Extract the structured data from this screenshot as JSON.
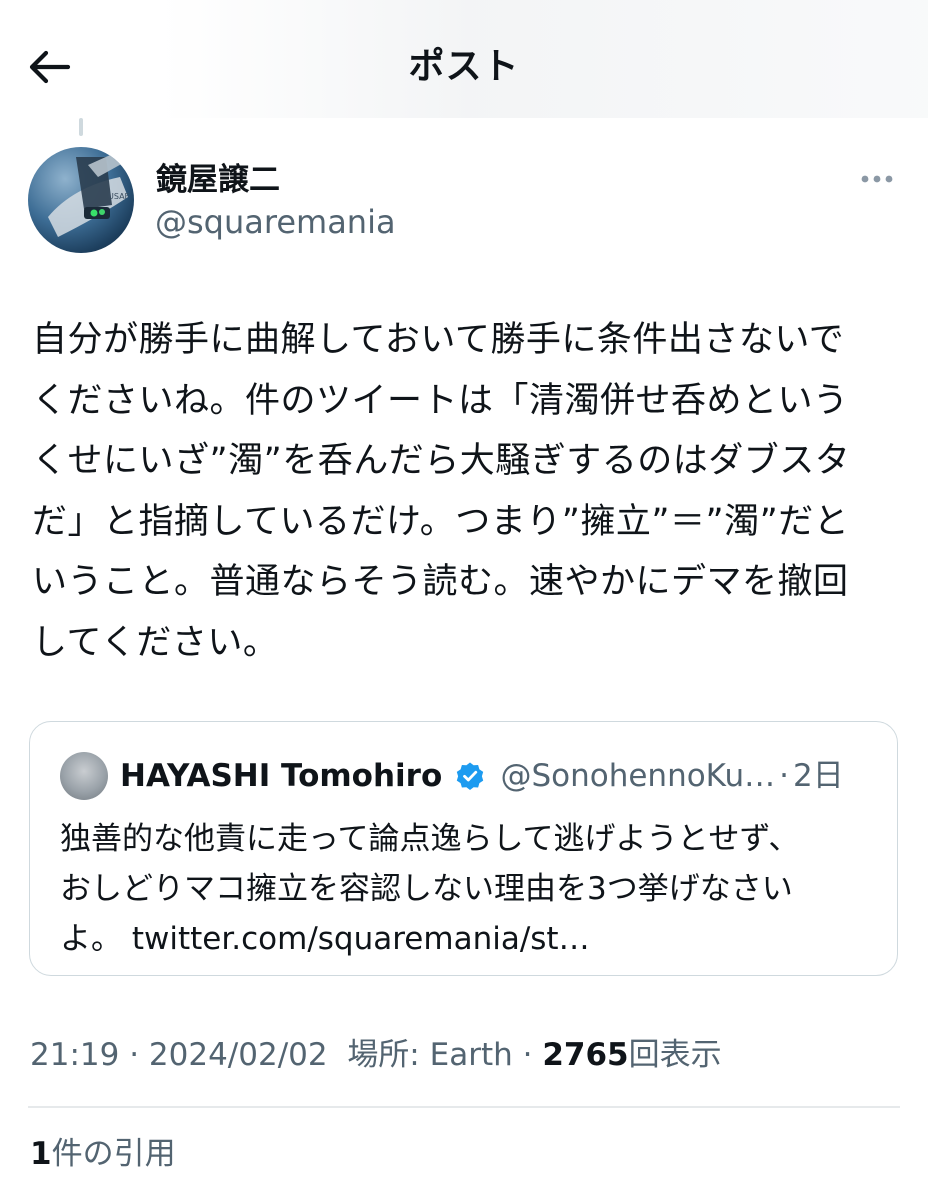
{
  "header": {
    "title": "ポスト",
    "back_icon": "arrow-left-icon"
  },
  "author": {
    "display_name": "鏡屋譲二",
    "handle": "@squaremania",
    "avatar_icon": "profile-avatar",
    "more_icon": "more-horizontal-icon"
  },
  "tweet": {
    "text": "自分が勝手に曲解しておいて勝手に条件出さないで\nくださいね。件のツイートは「清濁併せ呑めという\nくせにいざ”濁”を呑んだら大騒ぎするのはダブスタ\nだ」と指摘しているだけ。つまり”擁立”＝”濁”だと\nいうこと。普通ならそう読む。速やかにデマを撤回\nしてください。"
  },
  "quote": {
    "name": "HAYASHI Tomohiro",
    "verified_icon": "verified-badge-icon",
    "handle": "@SonohennoKu…",
    "separator": "·",
    "time": "2日",
    "text": "独善的な他責に走って論点逸らして逃げようとせず、\nおしどりマコ擁立を容認しない理由を3つ挙げなさい\nよ。 twitter.com/squaremania/st…"
  },
  "meta": {
    "time": "21:19",
    "sep1": " · ",
    "date": "2024/02/02",
    "location_label": "場所: ",
    "location": "Earth",
    "sep2": " · ",
    "views_count": "2765",
    "views_label": "回表示"
  },
  "quotes": {
    "count": "1",
    "label": "件の引用"
  },
  "colors": {
    "text": "#0f1419",
    "secondary": "#536471",
    "border": "#cfd9de",
    "verified": "#1d9bf0"
  }
}
